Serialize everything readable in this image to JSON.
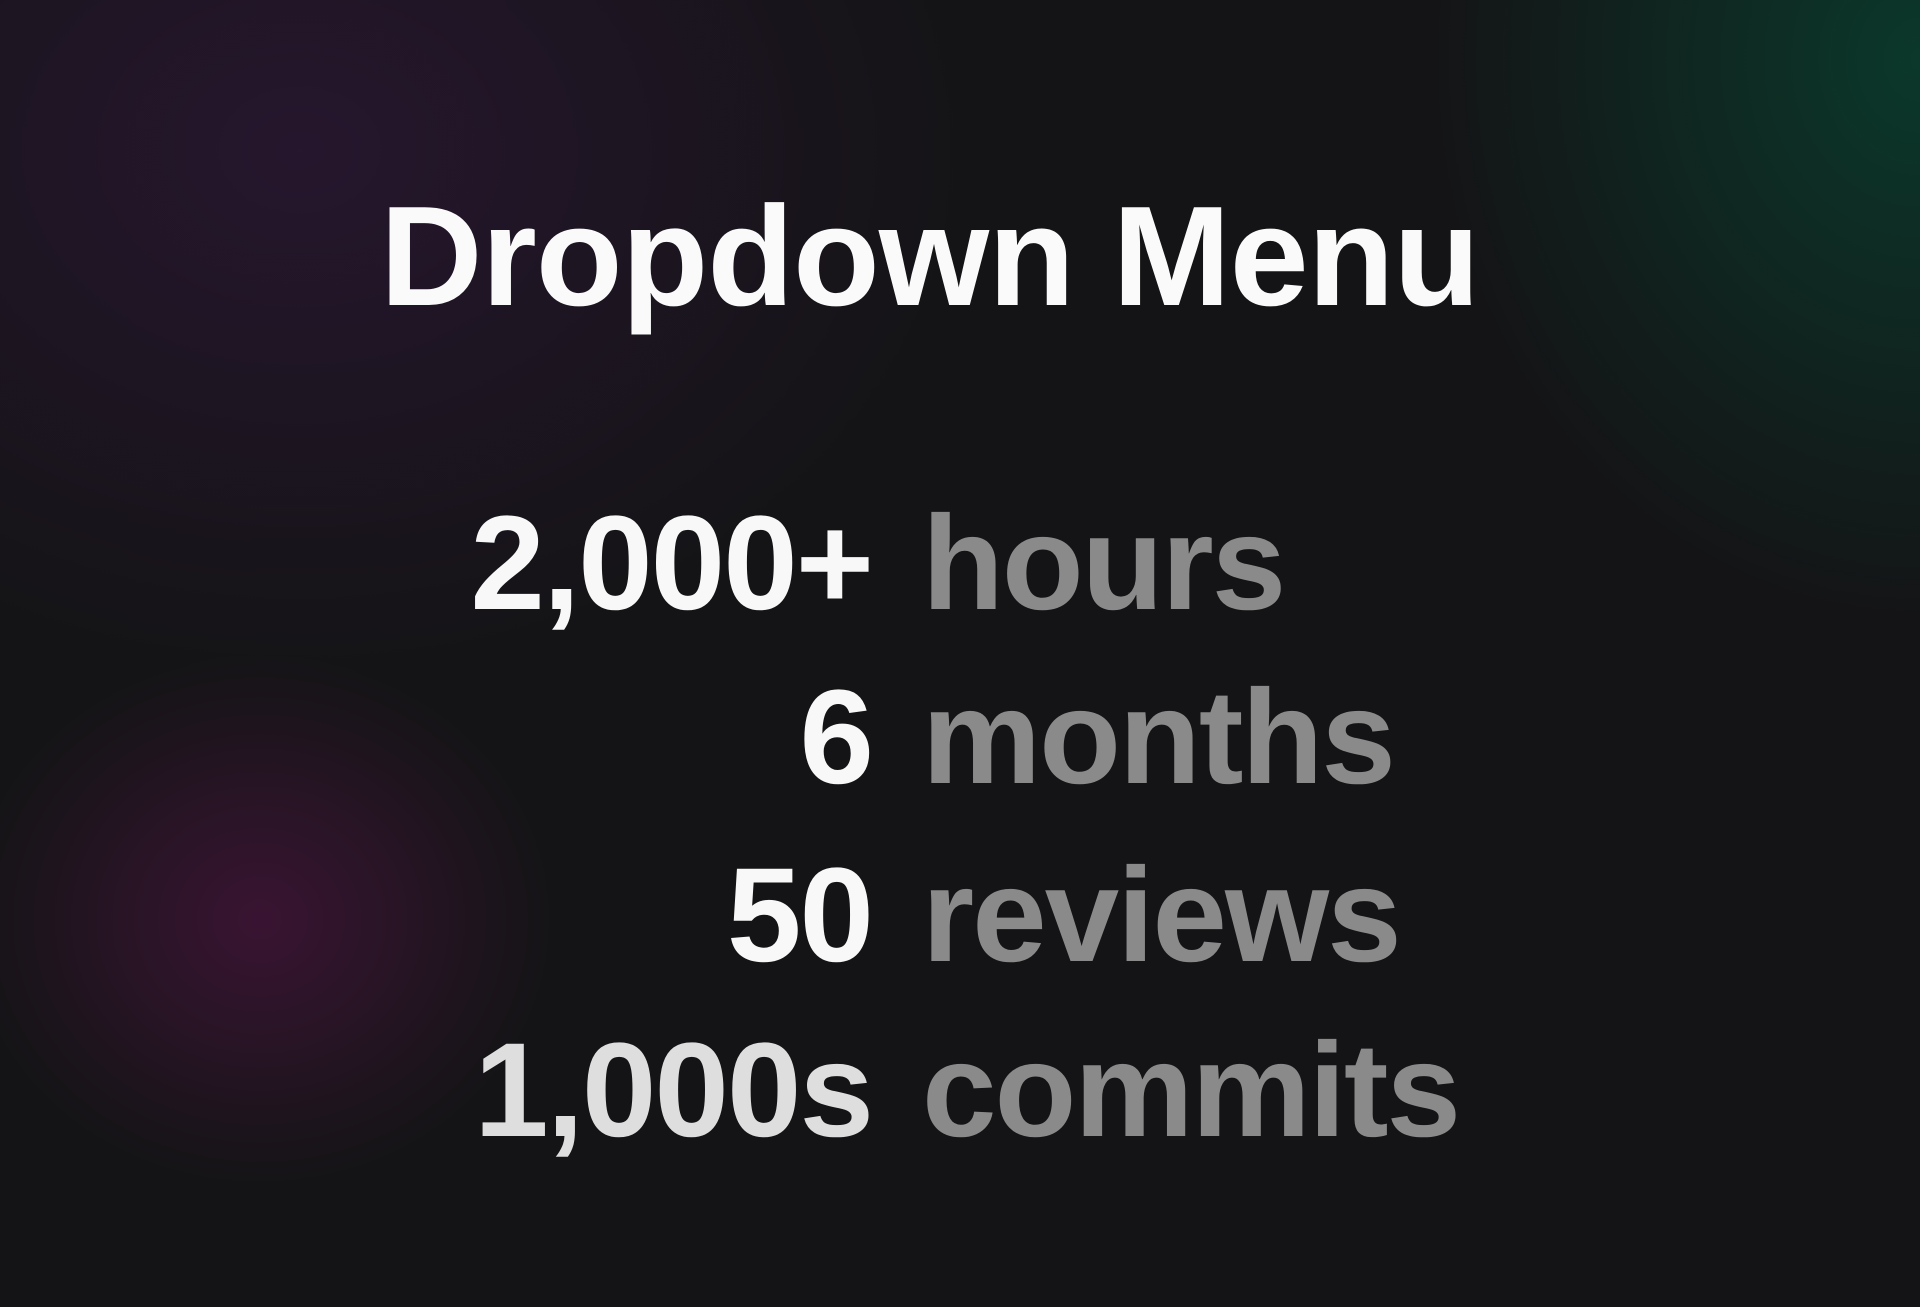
{
  "title": "Dropdown Menu",
  "stats": [
    {
      "value": "2,000+",
      "label": "hours"
    },
    {
      "value": "6",
      "label": "months"
    },
    {
      "value": "50",
      "label": "reviews"
    },
    {
      "value": "1,000s",
      "label": "commits"
    }
  ],
  "colors": {
    "number": "#f8f8f8",
    "label": "#8a8a8a",
    "background": "#141416"
  }
}
